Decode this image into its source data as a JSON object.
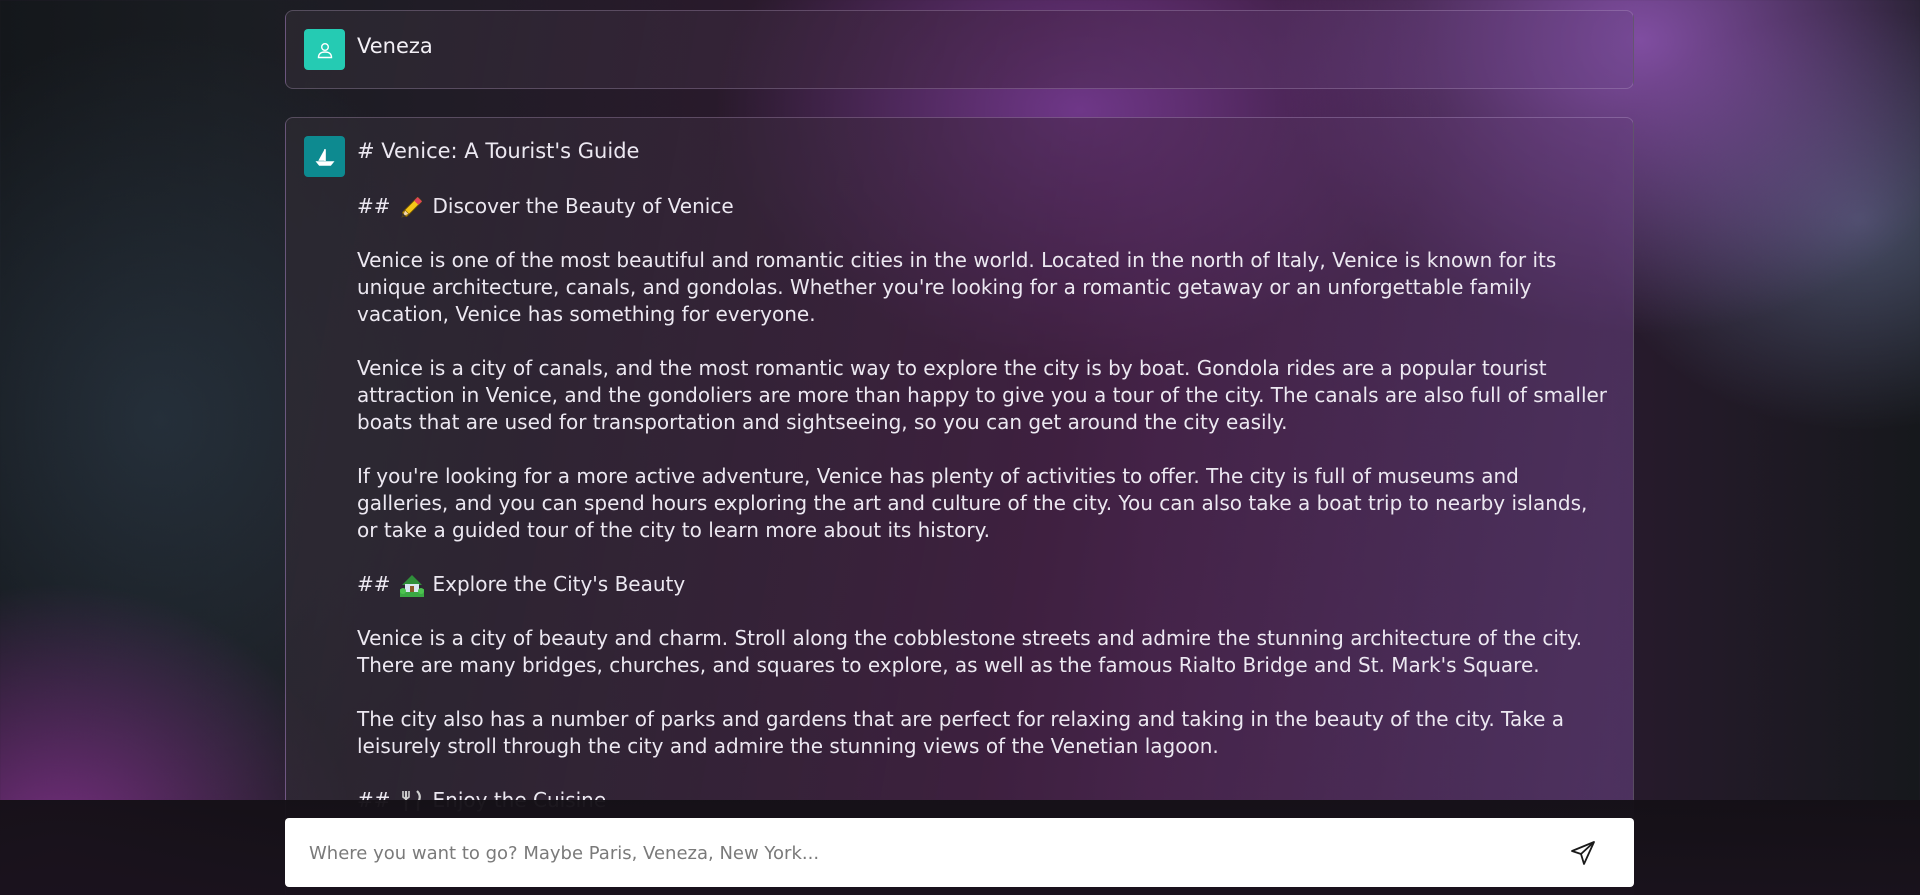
{
  "user_message": {
    "name": "Veneza",
    "avatar_icon": "user-icon",
    "avatar_color": "#25cbb3"
  },
  "assistant_message": {
    "avatar_icon": "sailboat-icon",
    "avatar_color": "#0d8a90",
    "title": "# Venice: A Tourist's Guide",
    "section1": {
      "prefix": "##",
      "icon": "pencil-icon",
      "heading": "Discover the Beauty of Venice",
      "paragraphs": [
        "Venice is one of the most beautiful and romantic cities in the world. Located in the north of Italy, Venice is known for its unique architecture, canals, and gondolas. Whether you're looking for a romantic getaway or an unforgettable family vacation, Venice has something for everyone.",
        "Venice is a city of canals, and the most romantic way to explore the city is by boat. Gondola rides are a popular tourist attraction in Venice, and the gondoliers are more than happy to give you a tour of the city. The canals are also full of smaller boats that are used for transportation and sightseeing, so you can get around the city easily.",
        "If you're looking for a more active adventure, Venice has plenty of activities to offer. The city is full of museums and galleries, and you can spend hours exploring the art and culture of the city. You can also take a boat trip to nearby islands, or take a guided tour of the city to learn more about its history."
      ]
    },
    "section2": {
      "prefix": "##",
      "icon": "house-with-garden-icon",
      "heading": "Explore the City's Beauty",
      "paragraphs": [
        "Venice is a city of beauty and charm. Stroll along the cobblestone streets and admire the stunning architecture of the city. There are many bridges, churches, and squares to explore, as well as the famous Rialto Bridge and St. Mark's Square.",
        "The city also has a number of parks and gardens that are perfect for relaxing and taking in the beauty of the city. Take a leisurely stroll through the city and admire the stunning views of the Venetian lagoon."
      ]
    },
    "section3": {
      "prefix": "##",
      "icon": "fork-and-knife-icon",
      "heading": "Enjoy the Cuisine"
    }
  },
  "search": {
    "placeholder": "Where you want to go? Maybe Paris, Veneza, New York...",
    "value": "",
    "send_icon": "send-icon"
  }
}
